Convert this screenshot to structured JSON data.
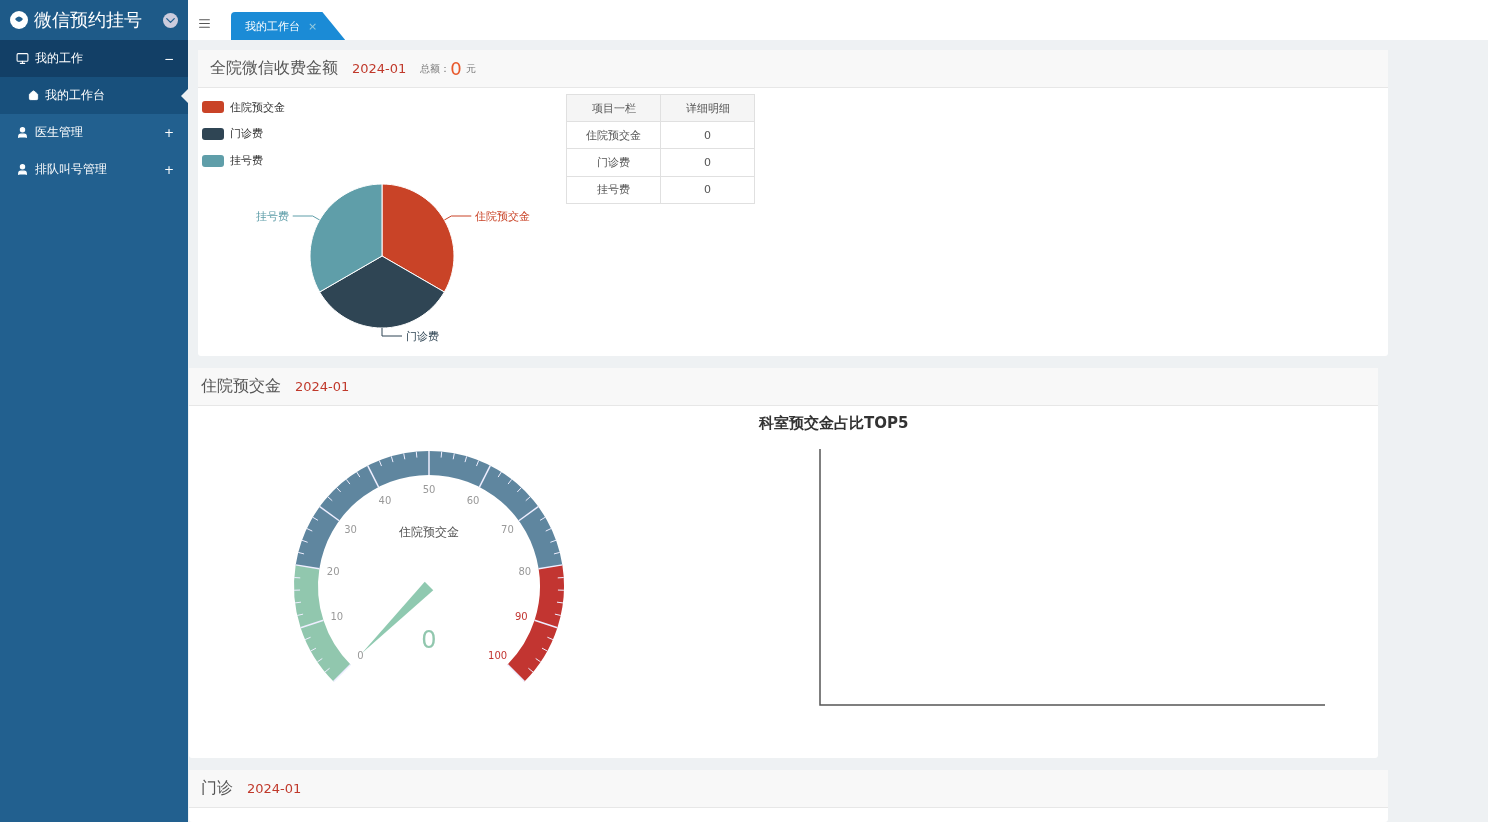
{
  "sidebar": {
    "brand": "微信预约挂号",
    "items": [
      {
        "label": "我的工作",
        "expanded": true,
        "toggle": "−",
        "children": [
          {
            "label": "我的工作台",
            "selected": true
          }
        ]
      },
      {
        "label": "医生管理",
        "expanded": false,
        "toggle": "+"
      },
      {
        "label": "排队叫号管理",
        "expanded": false,
        "toggle": "+"
      }
    ]
  },
  "tabs": [
    {
      "label": "我的工作台",
      "selected": true,
      "close": "×"
    }
  ],
  "panels": [
    {
      "kind": "pie",
      "title": "全院微信收费金额",
      "date": "2024-01",
      "total_label": "总额：",
      "total": "0",
      "unit": "元",
      "legend": [
        {
          "label": "住院预交金",
          "color": "#c94327"
        },
        {
          "label": "门诊费",
          "color": "#2f4554"
        },
        {
          "label": "挂号费",
          "color": "#5f9ea9"
        }
      ],
      "slice_labels": [
        "住院预交金",
        "门诊费",
        "挂号费"
      ],
      "table": {
        "columns": [
          "项目一栏",
          "详细明细"
        ],
        "rows": [
          [
            "住院预交金",
            "0"
          ],
          [
            "门诊费",
            "0"
          ],
          [
            "挂号费",
            "0"
          ]
        ]
      }
    },
    {
      "kind": "gauge",
      "title": "住院预交金",
      "date": "2024-01",
      "gauge": {
        "name": "住院预交金",
        "value": "0",
        "ticks": [
          "0",
          "10",
          "20",
          "30",
          "40",
          "50",
          "60",
          "70",
          "80",
          "90",
          "100"
        ]
      },
      "bar_title": "科室预交金占比TOP5"
    },
    {
      "kind": "header",
      "title": "门诊",
      "date": "2024-01"
    }
  ]
}
